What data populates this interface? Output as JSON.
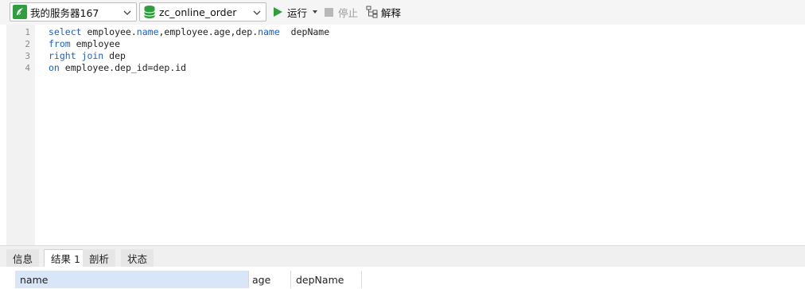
{
  "toolbar": {
    "connection": {
      "label": "我的服务器167",
      "icon": "mysql-connection-icon"
    },
    "database": {
      "label": "zc_online_order",
      "icon": "database-icon"
    },
    "run_label": "运行",
    "stop_label": "停止",
    "explain_label": "解释"
  },
  "editor": {
    "line_numbers": [
      "1",
      "2",
      "3",
      "4"
    ]
  },
  "tabs": {
    "info": "信息",
    "result": "结果 1",
    "profile": "剖析",
    "status": "状态"
  },
  "results": {
    "columns": [
      "name",
      "age",
      "depName"
    ]
  },
  "colors": {
    "keyword": "#1c5fd1",
    "run_green": "#2e9e3e",
    "selected_header": "#d8e6f7"
  }
}
